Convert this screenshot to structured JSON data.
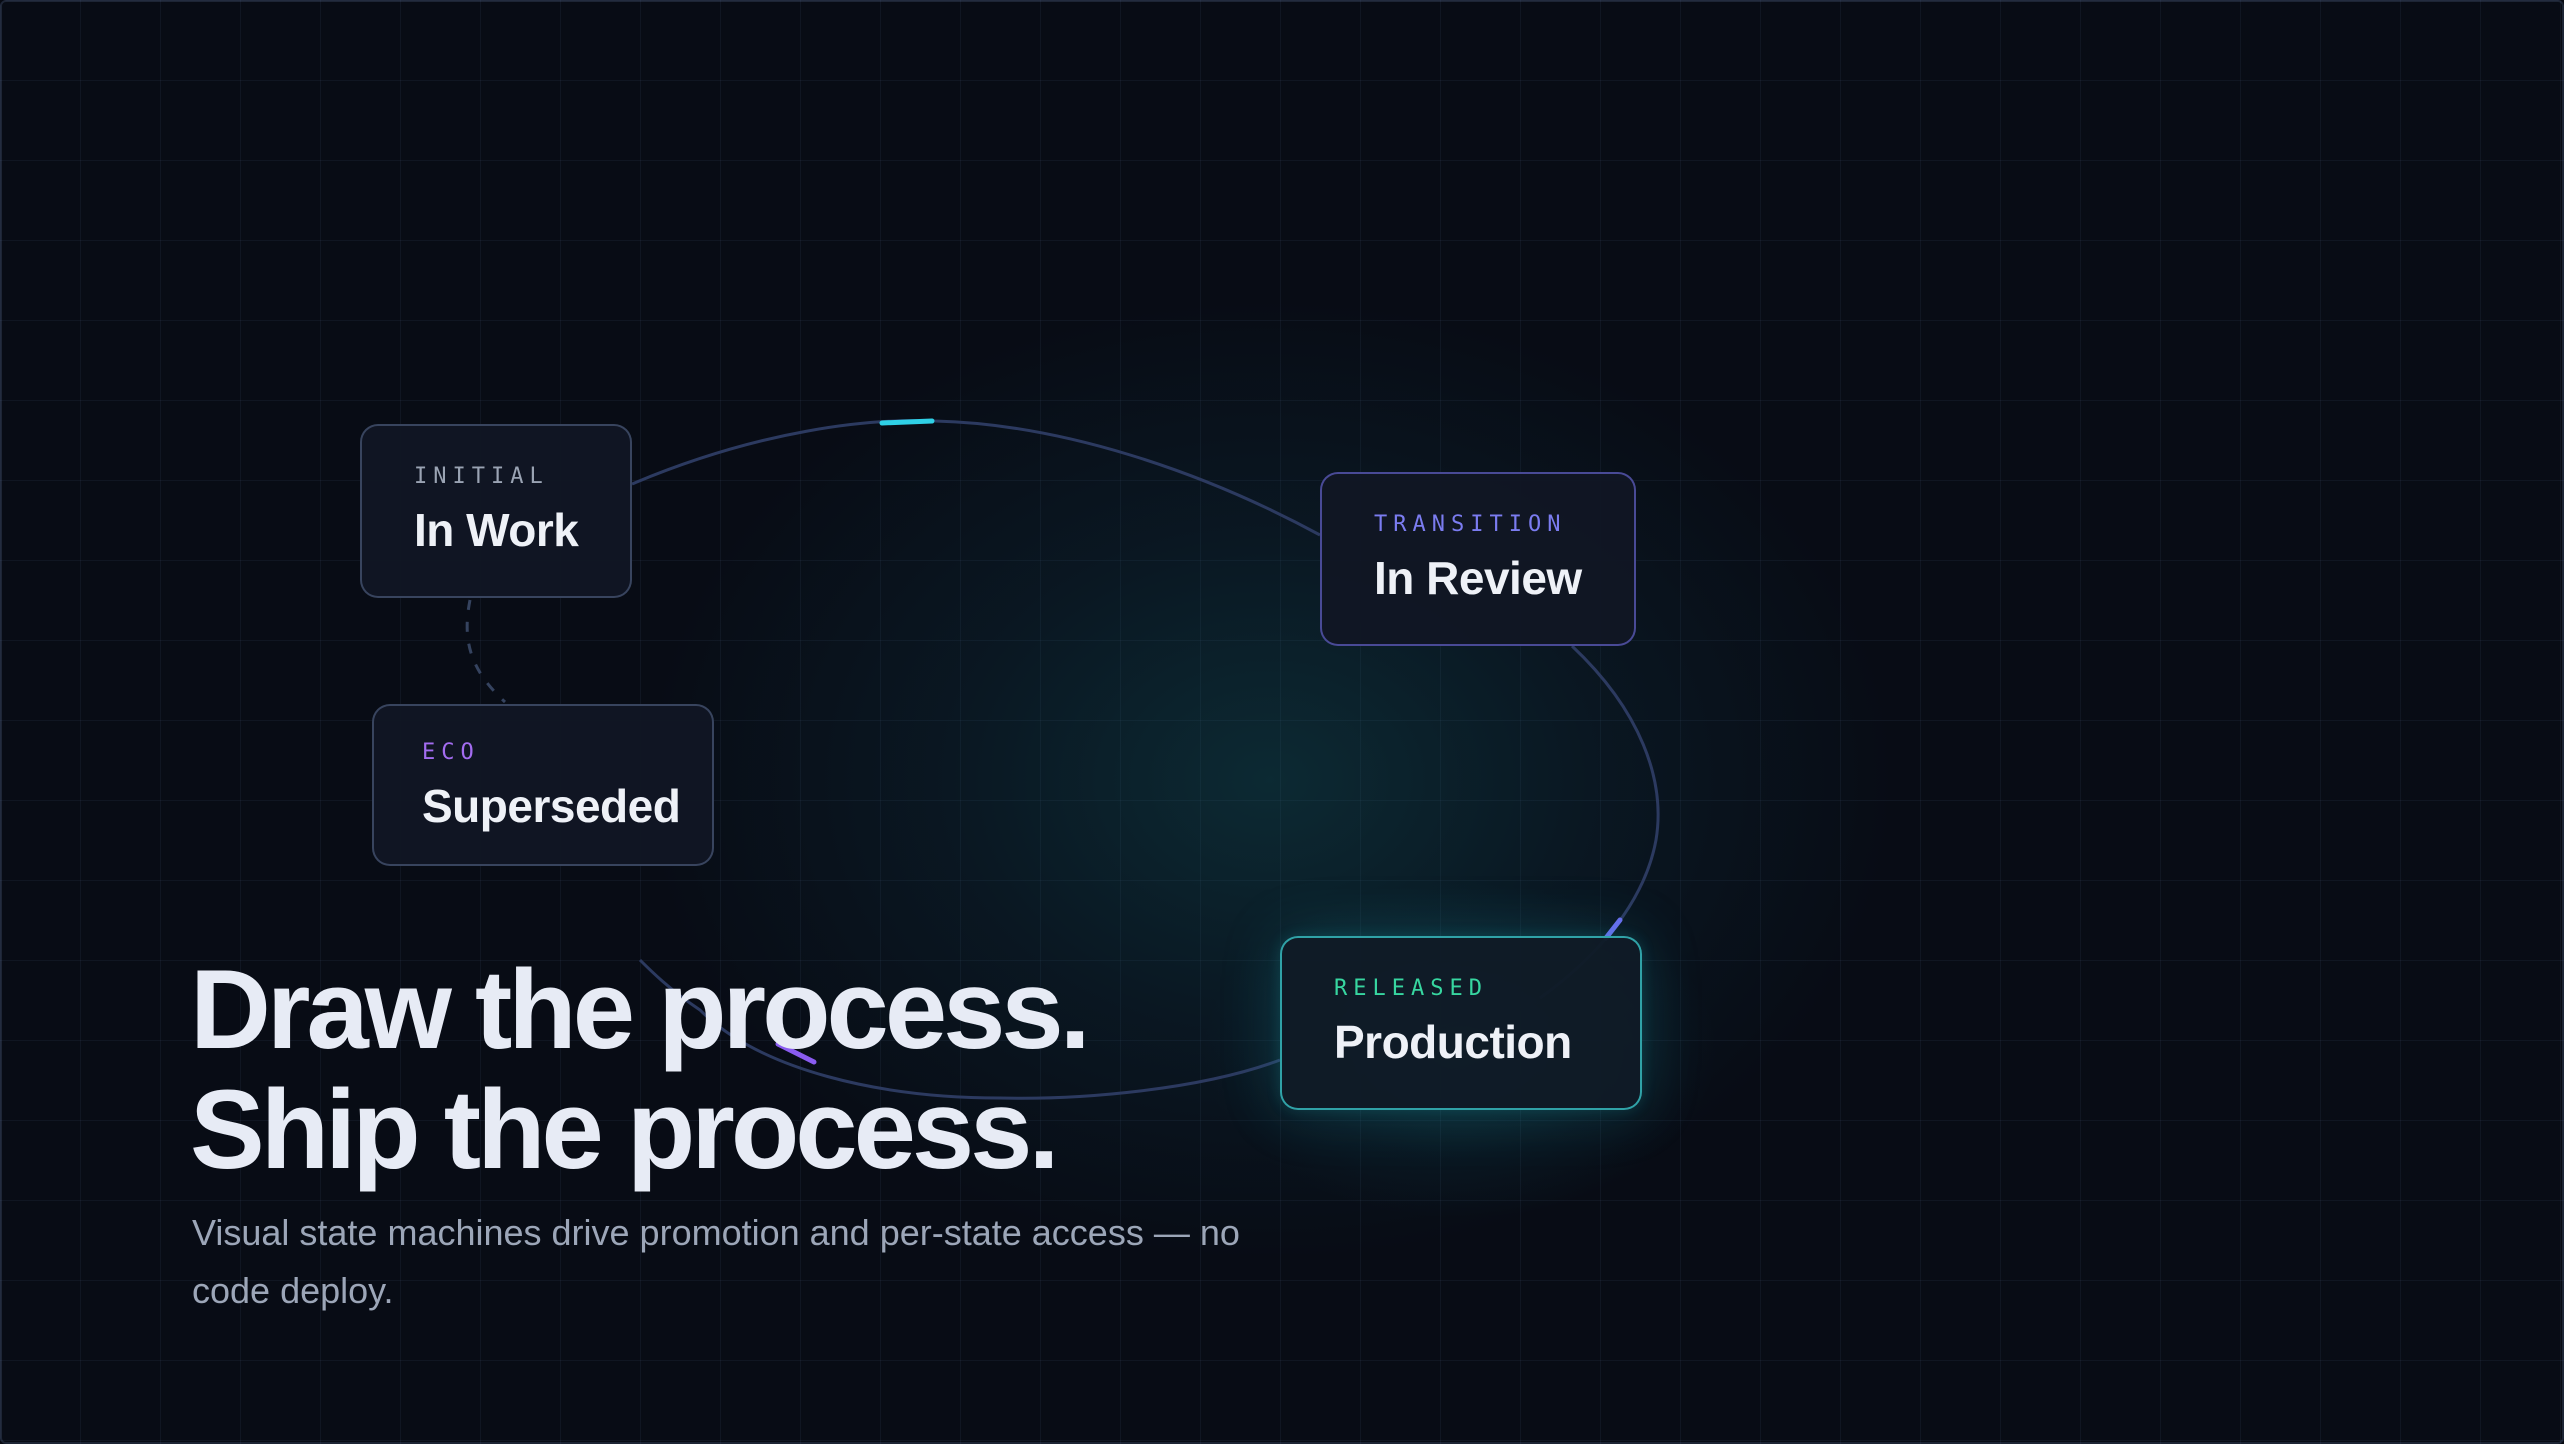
{
  "colors": {
    "background": "#080c15",
    "edge": "#2c3a60",
    "accent_cyan": "#2fd0e6",
    "accent_violet": "#8a5cf0",
    "accent_indigo": "#6b6df0",
    "released_green": "#37d6a0"
  },
  "nodes": {
    "in_work": {
      "tag": "INITIAL",
      "name": "In Work"
    },
    "in_review": {
      "tag": "TRANSITION",
      "name": "In Review"
    },
    "superseded": {
      "tag": "ECO",
      "name": "Superseded"
    },
    "production": {
      "tag": "RELEASED",
      "name": "Production"
    }
  },
  "edges": [
    {
      "from": "In Work",
      "to": "In Review"
    },
    {
      "from": "In Review",
      "to": "Production"
    },
    {
      "from": "Production",
      "to": "Superseded"
    },
    {
      "from": "In Work",
      "to": "Superseded",
      "style": "dashed"
    }
  ],
  "hero": {
    "headline_line1": "Draw the process.",
    "headline_line2": "Ship the process.",
    "subtext": "Visual state machines drive promotion and per-state access — no code deploy."
  }
}
